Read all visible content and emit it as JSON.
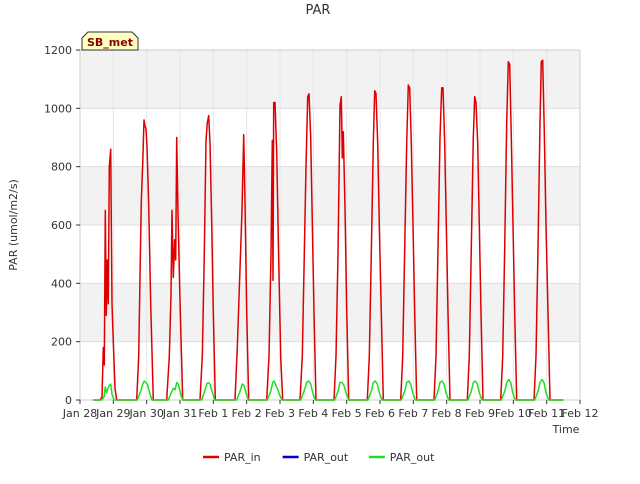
{
  "chart_data": {
    "type": "line",
    "title": "PAR",
    "xlabel": "Time",
    "ylabel": "PAR (umol/m2/s)",
    "ylim": [
      0,
      1200
    ],
    "yticks": [
      0,
      200,
      400,
      600,
      800,
      1000,
      1200
    ],
    "xlim": [
      0,
      15
    ],
    "xticks": [
      {
        "pos": 0,
        "label": "Jan 28"
      },
      {
        "pos": 1,
        "label": "Jan 29"
      },
      {
        "pos": 2,
        "label": "Jan 30"
      },
      {
        "pos": 3,
        "label": "Jan 31"
      },
      {
        "pos": 4,
        "label": "Feb 1"
      },
      {
        "pos": 5,
        "label": "Feb 2"
      },
      {
        "pos": 6,
        "label": "Feb 3"
      },
      {
        "pos": 7,
        "label": "Feb 4"
      },
      {
        "pos": 8,
        "label": "Feb 5"
      },
      {
        "pos": 9,
        "label": "Feb 6"
      },
      {
        "pos": 10,
        "label": "Feb 7"
      },
      {
        "pos": 11,
        "label": "Feb 8"
      },
      {
        "pos": 12,
        "label": "Feb 9"
      },
      {
        "pos": 13,
        "label": "Feb 10"
      },
      {
        "pos": 14,
        "label": "Feb 11"
      },
      {
        "pos": 15,
        "label": "Feb 12"
      }
    ],
    "grid": true,
    "legend_position": "bottom-center",
    "site_label": "SB_met",
    "series": [
      {
        "name": "PAR_in",
        "color": "#dd0000",
        "points": [
          [
            0.4,
            0
          ],
          [
            0.6,
            0
          ],
          [
            0.66,
            10
          ],
          [
            0.7,
            180
          ],
          [
            0.73,
            120
          ],
          [
            0.76,
            650
          ],
          [
            0.79,
            290
          ],
          [
            0.82,
            480
          ],
          [
            0.85,
            330
          ],
          [
            0.88,
            800
          ],
          [
            0.92,
            860
          ],
          [
            0.96,
            330
          ],
          [
            1.0,
            200
          ],
          [
            1.05,
            40
          ],
          [
            1.1,
            0
          ],
          [
            1.7,
            0
          ],
          [
            1.76,
            150
          ],
          [
            1.8,
            420
          ],
          [
            1.84,
            680
          ],
          [
            1.88,
            810
          ],
          [
            1.92,
            960
          ],
          [
            1.95,
            940
          ],
          [
            1.98,
            930
          ],
          [
            2.01,
            870
          ],
          [
            2.06,
            670
          ],
          [
            2.12,
            330
          ],
          [
            2.2,
            0
          ],
          [
            2.6,
            0
          ],
          [
            2.68,
            150
          ],
          [
            2.73,
            360
          ],
          [
            2.76,
            650
          ],
          [
            2.8,
            420
          ],
          [
            2.84,
            550
          ],
          [
            2.87,
            480
          ],
          [
            2.9,
            900
          ],
          [
            2.94,
            640
          ],
          [
            3.0,
            340
          ],
          [
            3.08,
            0
          ],
          [
            3.6,
            0
          ],
          [
            3.67,
            150
          ],
          [
            3.73,
            500
          ],
          [
            3.78,
            890
          ],
          [
            3.82,
            950
          ],
          [
            3.86,
            975
          ],
          [
            3.9,
            880
          ],
          [
            3.95,
            610
          ],
          [
            4.0,
            300
          ],
          [
            4.06,
            0
          ],
          [
            4.65,
            0
          ],
          [
            4.72,
            180
          ],
          [
            4.8,
            450
          ],
          [
            4.86,
            650
          ],
          [
            4.91,
            910
          ],
          [
            4.95,
            680
          ],
          [
            5.0,
            300
          ],
          [
            5.06,
            0
          ],
          [
            5.6,
            0
          ],
          [
            5.67,
            150
          ],
          [
            5.73,
            500
          ],
          [
            5.77,
            890
          ],
          [
            5.79,
            410
          ],
          [
            5.81,
            1020
          ],
          [
            5.85,
            1020
          ],
          [
            5.9,
            850
          ],
          [
            5.96,
            480
          ],
          [
            6.02,
            150
          ],
          [
            6.08,
            0
          ],
          [
            6.6,
            0
          ],
          [
            6.67,
            150
          ],
          [
            6.73,
            500
          ],
          [
            6.78,
            800
          ],
          [
            6.83,
            1040
          ],
          [
            6.87,
            1050
          ],
          [
            6.92,
            900
          ],
          [
            6.97,
            610
          ],
          [
            7.02,
            300
          ],
          [
            7.08,
            0
          ],
          [
            7.62,
            0
          ],
          [
            7.68,
            150
          ],
          [
            7.74,
            500
          ],
          [
            7.8,
            1010
          ],
          [
            7.84,
            1040
          ],
          [
            7.87,
            830
          ],
          [
            7.9,
            920
          ],
          [
            7.95,
            660
          ],
          [
            8.0,
            310
          ],
          [
            8.06,
            0
          ],
          [
            8.62,
            0
          ],
          [
            8.68,
            150
          ],
          [
            8.74,
            500
          ],
          [
            8.8,
            880
          ],
          [
            8.84,
            1060
          ],
          [
            8.88,
            1050
          ],
          [
            8.93,
            880
          ],
          [
            8.98,
            600
          ],
          [
            9.04,
            300
          ],
          [
            9.1,
            0
          ],
          [
            9.62,
            0
          ],
          [
            9.68,
            150
          ],
          [
            9.74,
            520
          ],
          [
            9.8,
            880
          ],
          [
            9.85,
            1080
          ],
          [
            9.89,
            1070
          ],
          [
            9.94,
            880
          ],
          [
            9.99,
            600
          ],
          [
            10.04,
            300
          ],
          [
            10.1,
            0
          ],
          [
            10.62,
            0
          ],
          [
            10.68,
            150
          ],
          [
            10.74,
            520
          ],
          [
            10.8,
            900
          ],
          [
            10.85,
            1070
          ],
          [
            10.89,
            1070
          ],
          [
            10.94,
            880
          ],
          [
            10.99,
            600
          ],
          [
            11.04,
            300
          ],
          [
            11.1,
            0
          ],
          [
            11.62,
            0
          ],
          [
            11.68,
            150
          ],
          [
            11.74,
            520
          ],
          [
            11.8,
            900
          ],
          [
            11.84,
            1040
          ],
          [
            11.88,
            1020
          ],
          [
            11.93,
            880
          ],
          [
            11.98,
            600
          ],
          [
            12.03,
            300
          ],
          [
            12.09,
            0
          ],
          [
            12.62,
            0
          ],
          [
            12.68,
            150
          ],
          [
            12.74,
            520
          ],
          [
            12.8,
            950
          ],
          [
            12.85,
            1160
          ],
          [
            12.89,
            1150
          ],
          [
            12.94,
            900
          ],
          [
            12.99,
            600
          ],
          [
            13.04,
            300
          ],
          [
            13.1,
            0
          ],
          [
            13.62,
            0
          ],
          [
            13.68,
            150
          ],
          [
            13.74,
            520
          ],
          [
            13.8,
            950
          ],
          [
            13.84,
            1160
          ],
          [
            13.88,
            1165
          ],
          [
            13.93,
            920
          ],
          [
            13.98,
            600
          ],
          [
            14.04,
            300
          ],
          [
            14.1,
            0
          ],
          [
            14.5,
            0
          ]
        ]
      },
      {
        "name": "PAR_out",
        "color": "#0000cc",
        "points": []
      },
      {
        "name": "PAR_out",
        "color": "#22dd22",
        "points": [
          [
            0.4,
            0
          ],
          [
            0.65,
            0
          ],
          [
            0.72,
            10
          ],
          [
            0.76,
            45
          ],
          [
            0.8,
            25
          ],
          [
            0.84,
            40
          ],
          [
            0.88,
            50
          ],
          [
            0.92,
            55
          ],
          [
            0.96,
            20
          ],
          [
            1.02,
            0
          ],
          [
            1.72,
            0
          ],
          [
            1.82,
            30
          ],
          [
            1.88,
            55
          ],
          [
            1.93,
            65
          ],
          [
            1.97,
            60
          ],
          [
            2.02,
            55
          ],
          [
            2.1,
            20
          ],
          [
            2.16,
            0
          ],
          [
            2.65,
            0
          ],
          [
            2.74,
            25
          ],
          [
            2.8,
            40
          ],
          [
            2.85,
            35
          ],
          [
            2.9,
            60
          ],
          [
            2.95,
            55
          ],
          [
            3.02,
            20
          ],
          [
            3.08,
            0
          ],
          [
            3.65,
            0
          ],
          [
            3.74,
            30
          ],
          [
            3.8,
            55
          ],
          [
            3.85,
            60
          ],
          [
            3.9,
            55
          ],
          [
            3.96,
            30
          ],
          [
            4.04,
            0
          ],
          [
            4.7,
            0
          ],
          [
            4.8,
            30
          ],
          [
            4.87,
            55
          ],
          [
            4.92,
            50
          ],
          [
            4.98,
            25
          ],
          [
            5.05,
            0
          ],
          [
            5.62,
            0
          ],
          [
            5.72,
            30
          ],
          [
            5.78,
            60
          ],
          [
            5.82,
            65
          ],
          [
            5.86,
            55
          ],
          [
            5.92,
            40
          ],
          [
            5.98,
            20
          ],
          [
            6.06,
            0
          ],
          [
            6.62,
            0
          ],
          [
            6.72,
            30
          ],
          [
            6.8,
            60
          ],
          [
            6.86,
            65
          ],
          [
            6.92,
            55
          ],
          [
            6.98,
            25
          ],
          [
            7.06,
            0
          ],
          [
            7.64,
            0
          ],
          [
            7.74,
            30
          ],
          [
            7.8,
            60
          ],
          [
            7.86,
            60
          ],
          [
            7.92,
            50
          ],
          [
            7.98,
            25
          ],
          [
            8.06,
            0
          ],
          [
            8.64,
            0
          ],
          [
            8.74,
            30
          ],
          [
            8.8,
            60
          ],
          [
            8.86,
            65
          ],
          [
            8.92,
            55
          ],
          [
            8.98,
            25
          ],
          [
            9.06,
            0
          ],
          [
            9.64,
            0
          ],
          [
            9.74,
            30
          ],
          [
            9.8,
            60
          ],
          [
            9.86,
            65
          ],
          [
            9.92,
            55
          ],
          [
            9.98,
            25
          ],
          [
            10.06,
            0
          ],
          [
            10.64,
            0
          ],
          [
            10.74,
            30
          ],
          [
            10.8,
            60
          ],
          [
            10.86,
            65
          ],
          [
            10.92,
            55
          ],
          [
            10.98,
            25
          ],
          [
            11.06,
            0
          ],
          [
            11.64,
            0
          ],
          [
            11.74,
            30
          ],
          [
            11.8,
            60
          ],
          [
            11.86,
            65
          ],
          [
            11.92,
            55
          ],
          [
            11.98,
            25
          ],
          [
            12.06,
            0
          ],
          [
            12.64,
            0
          ],
          [
            12.74,
            30
          ],
          [
            12.8,
            60
          ],
          [
            12.86,
            70
          ],
          [
            12.92,
            60
          ],
          [
            12.98,
            25
          ],
          [
            13.06,
            0
          ],
          [
            13.64,
            0
          ],
          [
            13.74,
            30
          ],
          [
            13.8,
            60
          ],
          [
            13.86,
            70
          ],
          [
            13.92,
            60
          ],
          [
            13.98,
            25
          ],
          [
            14.06,
            0
          ],
          [
            14.5,
            0
          ]
        ]
      }
    ]
  }
}
